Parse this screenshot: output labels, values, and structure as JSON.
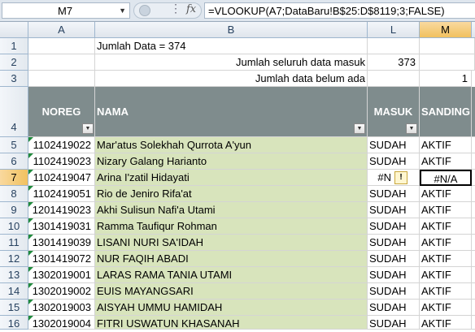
{
  "formula_bar": {
    "name_box": "M7",
    "fx_label": "fx",
    "formula": "=VLOOKUP(A7;DataBaru!B$25:D$8119;3;FALSE)"
  },
  "columns": [
    "A",
    "B",
    "L",
    "M"
  ],
  "row_numbers": [
    "1",
    "2",
    "3",
    "4",
    "5",
    "6",
    "7",
    "8",
    "9",
    "10",
    "11",
    "12",
    "13",
    "14",
    "15",
    "16"
  ],
  "summary": {
    "jumlah_data": "Jumlah Data = 374",
    "seluruh_label": "Jumlah seluruh data masuk",
    "seluruh_value": "373",
    "belum_label": "Jumlah data belum ada",
    "belum_value": "1"
  },
  "table_headers": {
    "noreg": "NOREG",
    "nama": "NAMA",
    "masuk": "MASUK",
    "sanding": "SANDING"
  },
  "rows": [
    {
      "noreg": "1102419022",
      "nama": "Mar'atus Solekhah Qurrota A'yun",
      "masuk": "SUDAH",
      "sanding": "AKTIF"
    },
    {
      "noreg": "1102419023",
      "nama": "Nizary Galang Harianto",
      "masuk": "SUDAH",
      "sanding": "AKTIF"
    },
    {
      "noreg": "1102419047",
      "nama": "Arina I'zatil Hidayati",
      "masuk": "#N",
      "sanding": "#N/A"
    },
    {
      "noreg": "1102419051",
      "nama": "Rio de Jeniro Rifa'at",
      "masuk": "SUDAH",
      "sanding": "AKTIF"
    },
    {
      "noreg": "1201419023",
      "nama": "Akhi Sulisun Nafi'a Utami",
      "masuk": "SUDAH",
      "sanding": "AKTIF"
    },
    {
      "noreg": "1301419031",
      "nama": "Ramma Taufiqur Rohman",
      "masuk": "SUDAH",
      "sanding": "AKTIF"
    },
    {
      "noreg": "1301419039",
      "nama": "LISANI NURI SA'IDAH",
      "masuk": "SUDAH",
      "sanding": "AKTIF"
    },
    {
      "noreg": "1301419072",
      "nama": "NUR FAQIH ABADI",
      "masuk": "SUDAH",
      "sanding": "AKTIF"
    },
    {
      "noreg": "1302019001",
      "nama": "LARAS RAMA TANIA UTAMI",
      "masuk": "SUDAH",
      "sanding": "AKTIF"
    },
    {
      "noreg": "1302019002",
      "nama": "EUIS MAYANGSARI",
      "masuk": "SUDAH",
      "sanding": "AKTIF"
    },
    {
      "noreg": "1302019003",
      "nama": "AISYAH UMMU HAMIDAH",
      "masuk": "SUDAH",
      "sanding": "AKTIF"
    },
    {
      "noreg": "1302019004",
      "nama": "FITRI USWATUN KHASANAH",
      "masuk": "SUDAH",
      "sanding": "AKTIF"
    }
  ]
}
